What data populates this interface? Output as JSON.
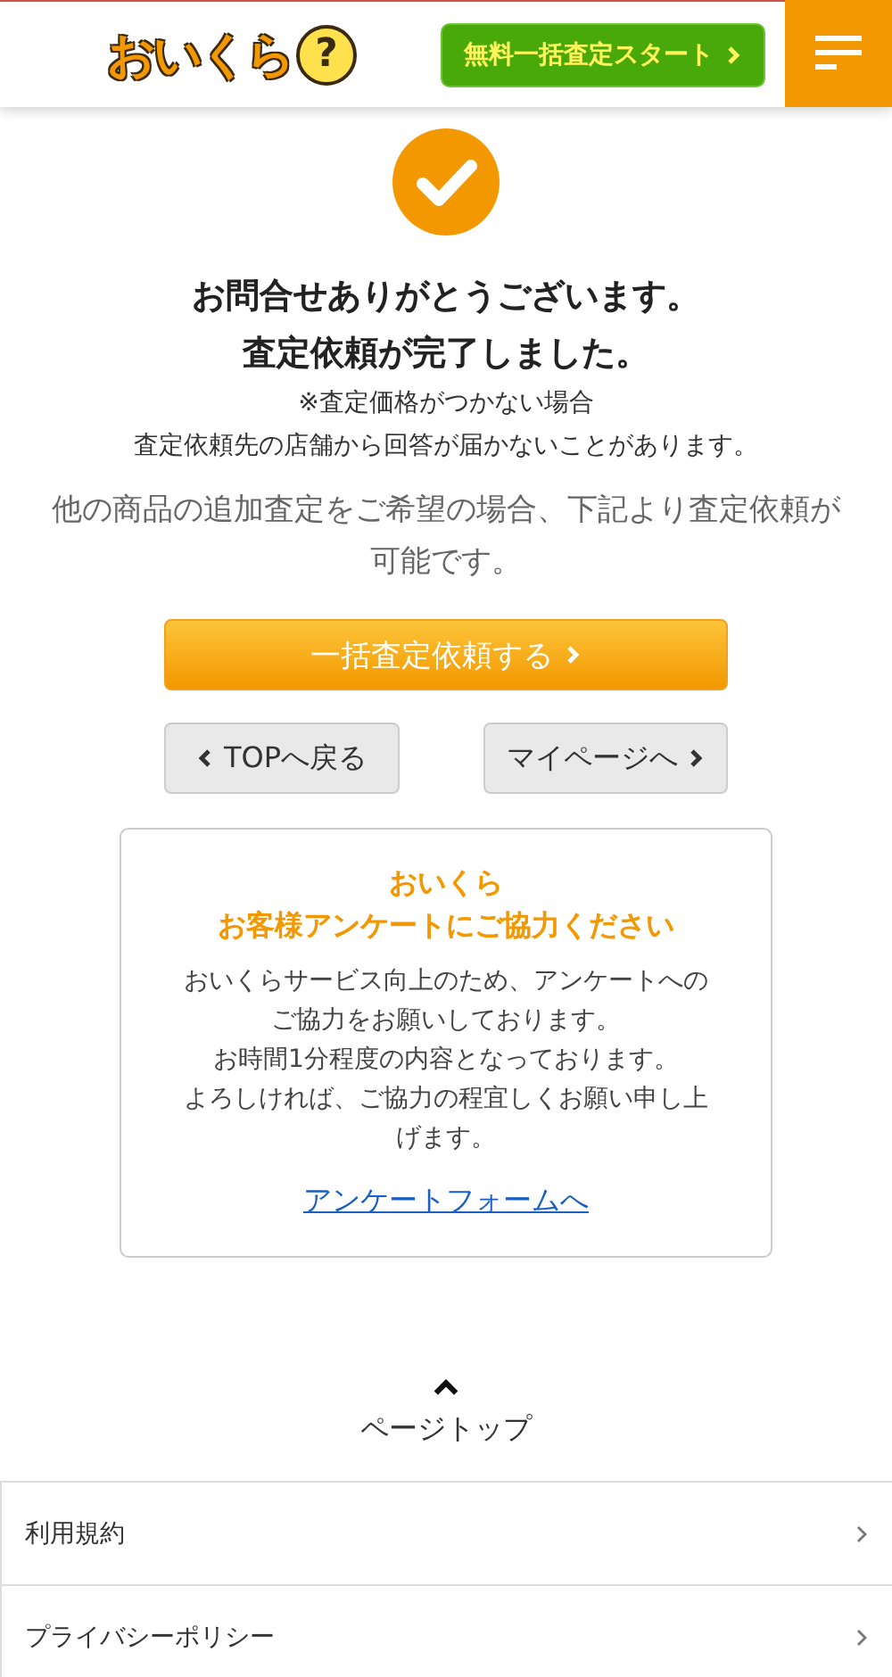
{
  "header": {
    "logo_text": "おいくら",
    "logo_mark": "?",
    "cta": "無料一括査定スタート"
  },
  "completion": {
    "title_lines": [
      "お問合せありがとうございます。",
      "査定依頼が完了しました。"
    ],
    "note_lines": [
      "※査定価格がつかない場合",
      "査定依頼先の店舗から回答が届かないことがあります。"
    ],
    "message": "他の商品の追加査定をご希望の場合、下記より査定依頼が可能です。"
  },
  "primary_button": "一括査定依頼する",
  "nav_buttons": [
    {
      "label": "TOPへ戻る",
      "kind": "back"
    },
    {
      "label": "マイページへ",
      "kind": "forward"
    }
  ],
  "survey": {
    "title_lines": [
      "おいくら",
      "お客様アンケートにご協力ください"
    ],
    "body_lines": [
      "おいくらサービス向上のため、アンケートへの",
      "ご協力をお願いしております。",
      "お時間1分程度の内容となっております。",
      "よろしければ、ご協力の程宜しくお願い申し上げます。"
    ],
    "link": "アンケートフォームへ"
  },
  "page_top": "ページトップ",
  "footer_links": [
    "利用規約",
    "プライバシーポリシー"
  ]
}
